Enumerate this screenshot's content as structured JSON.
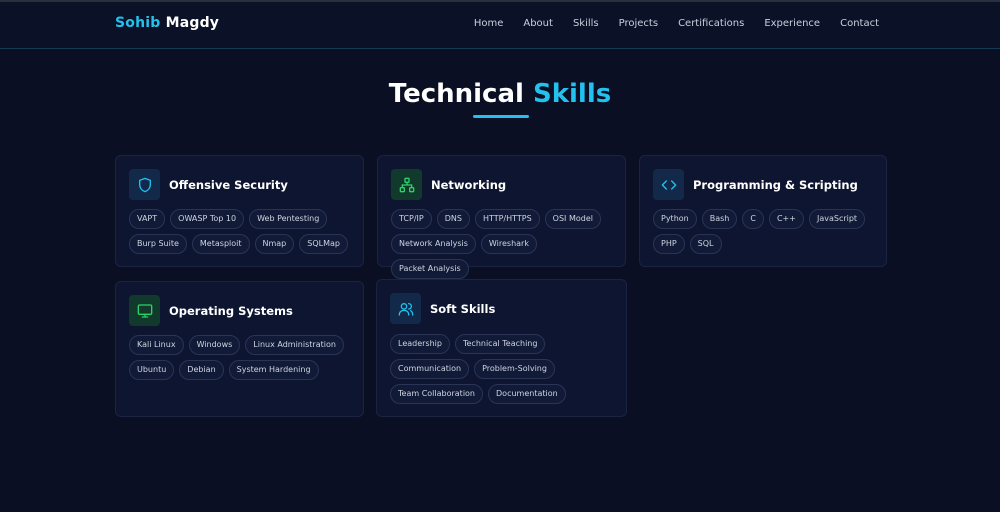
{
  "brand": {
    "first": "Sohib",
    "last": "Magdy"
  },
  "nav": [
    "Home",
    "About",
    "Skills",
    "Projects",
    "Certifications",
    "Experience",
    "Contact"
  ],
  "section": {
    "title_main": "Technical",
    "title_accent": "Skills"
  },
  "colors": {
    "accent": "#22c1ee",
    "background": "#0a0f24",
    "card": "#0e1530"
  },
  "cards": [
    {
      "title": "Offensive Security",
      "icon": "shield-icon",
      "tags": [
        "VAPT",
        "OWASP Top 10",
        "Web Pentesting",
        "Burp Suite",
        "Metasploit",
        "Nmap",
        "SQLMap"
      ]
    },
    {
      "title": "Networking",
      "icon": "network-icon",
      "tags": [
        "TCP/IP",
        "DNS",
        "HTTP/HTTPS",
        "OSI Model",
        "Network Analysis",
        "Wireshark",
        "Packet Analysis"
      ]
    },
    {
      "title": "Programming & Scripting",
      "icon": "code-icon",
      "tags": [
        "Python",
        "Bash",
        "C",
        "C++",
        "JavaScript",
        "PHP",
        "SQL"
      ]
    },
    {
      "title": "Operating Systems",
      "icon": "monitor-icon",
      "tags": [
        "Kali Linux",
        "Windows",
        "Linux Administration",
        "Ubuntu",
        "Debian",
        "System Hardening"
      ]
    },
    {
      "title": "Soft Skills",
      "icon": "users-icon",
      "tags": [
        "Leadership",
        "Technical Teaching",
        "Communication",
        "Problem-Solving",
        "Team Collaboration",
        "Documentation"
      ]
    }
  ]
}
